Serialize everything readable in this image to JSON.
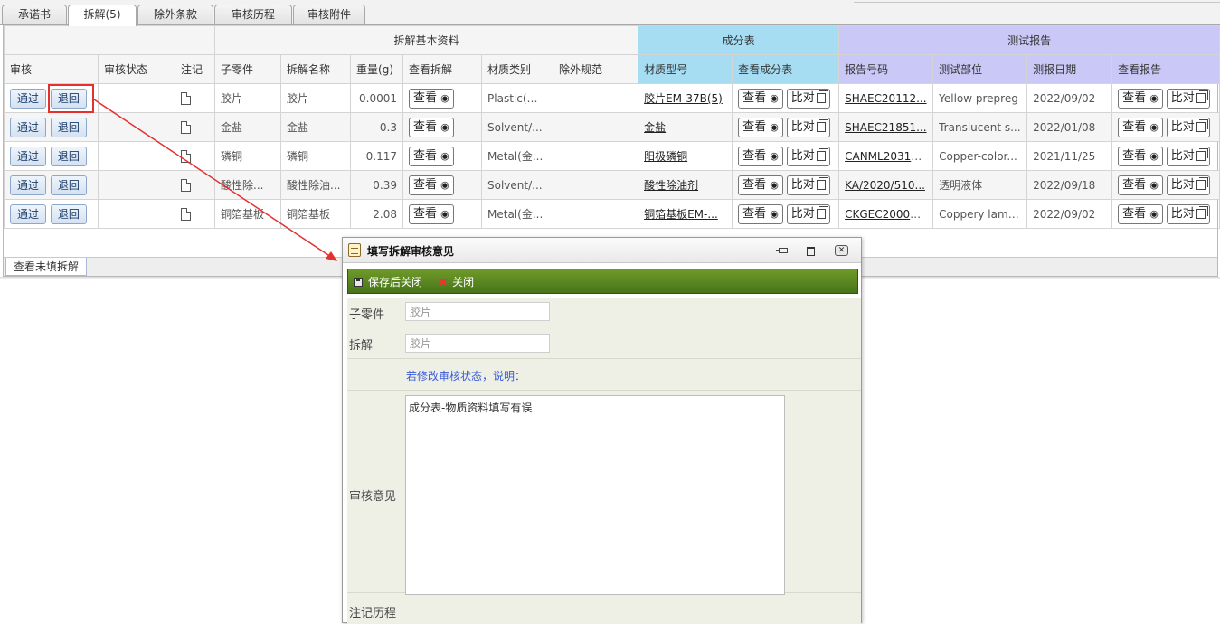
{
  "tabs": [
    {
      "label": "承诺书"
    },
    {
      "label": "拆解(5)"
    },
    {
      "label": "除外条款"
    },
    {
      "label": "审核历程"
    },
    {
      "label": "审核附件"
    }
  ],
  "grid": {
    "groups": {
      "basic": "拆解基本资料",
      "composition": "成分表",
      "test_report": "测试报告"
    },
    "columns": [
      "审核",
      "审核状态",
      "注记",
      "子零件",
      "拆解名称",
      "重量(g)",
      "查看拆解",
      "材质类别",
      "除外规范",
      "材质型号",
      "查看成分表",
      "报告号码",
      "测试部位",
      "测报日期",
      "查看报告"
    ],
    "approve_label": "通过",
    "return_label": "退回",
    "view_label": "查看",
    "compare_label": "比对",
    "rows": [
      {
        "part": "胶片",
        "name": "胶片",
        "weight": "0.0001",
        "material": "Plastic(塑...",
        "exclusion": "",
        "model": "胶片EM-37B(5)",
        "report_no": "SHAEC20112...",
        "test_part": "Yellow prepreg",
        "date": "2022/09/02"
      },
      {
        "part": "金盐",
        "name": "金盐",
        "weight": "0.3",
        "material": "Solvent/...",
        "exclusion": "",
        "model": "金盐",
        "report_no": "SHAEC21851...",
        "test_part": "Translucent s...",
        "date": "2022/01/08"
      },
      {
        "part": "磷铜",
        "name": "磷铜",
        "weight": "0.117",
        "material": "Metal(金...",
        "exclusion": "",
        "model": "阳极磷铜",
        "report_no": "CANML20319...",
        "test_part": "Copper-color...",
        "date": "2021/11/25"
      },
      {
        "part": "酸性除...",
        "name": "酸性除油...",
        "weight": "0.39",
        "material": "Solvent/...",
        "exclusion": "",
        "model": "酸性除油剂",
        "report_no": "KA/2020/510...",
        "test_part": "透明液体",
        "date": "2022/09/18"
      },
      {
        "part": "铜箔基板",
        "name": "铜箔基板",
        "weight": "2.08",
        "material": "Metal(金...",
        "exclusion": "",
        "model": "铜箔基板EM-...",
        "report_no": "CKGEC20007...",
        "test_part": "Coppery lami...",
        "date": "2022/09/02"
      }
    ]
  },
  "bottom_tab": {
    "label": "查看未填拆解"
  },
  "dialog": {
    "title": "填写拆解审核意见",
    "toolbar": {
      "save_close": "保存后关闭",
      "close": "关闭"
    },
    "form": {
      "part_label": "子零件",
      "part_value": "胶片",
      "disassembly_label": "拆解",
      "disassembly_value": "胶片",
      "hint": "若修改审核状态，说明：",
      "opinion_label": "审核意见",
      "opinion_value": "成分表-物质资料填写有误",
      "history_label": "注记历程"
    }
  },
  "colors": {
    "composition_header": "#a6ddf2",
    "test_report_header": "#cac8f6",
    "toolbar_green": "#4f7f1d",
    "highlight_red": "#e53030"
  }
}
